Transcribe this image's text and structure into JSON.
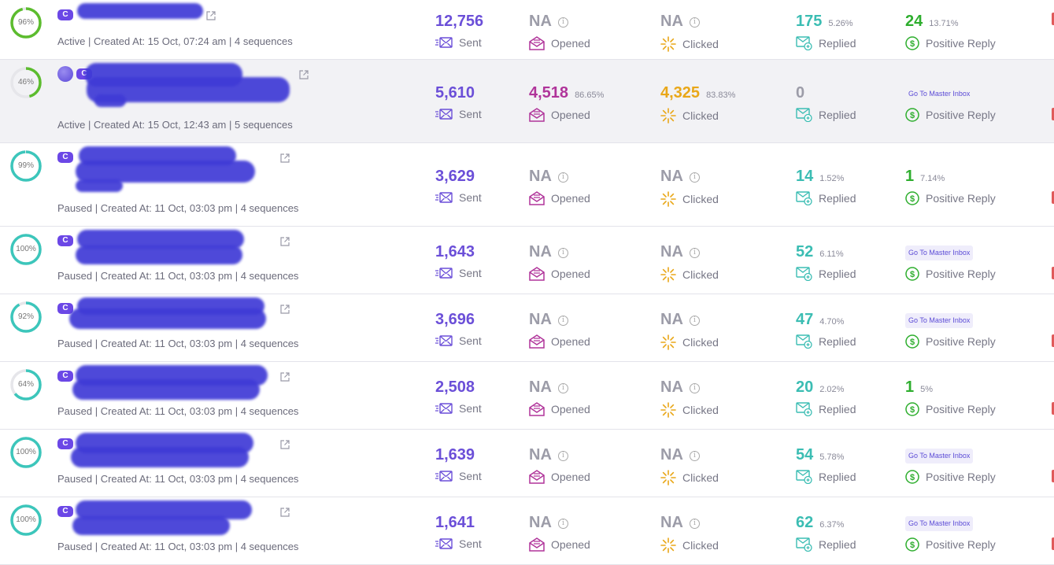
{
  "colors": {
    "sent": "#6b4fd8",
    "opened": "#b0349a",
    "clicked": "#e9a718",
    "replied": "#3bbdb3",
    "positive": "#2eae2e",
    "na": "#9c9ca8",
    "ring_green": "#5cbc2e",
    "ring_teal": "#3cc6bb"
  },
  "labels": {
    "sent": "Sent",
    "opened": "Opened",
    "clicked": "Clicked",
    "replied": "Replied",
    "positive_reply": "Positive Reply",
    "go_to_master_inbox": "Go To Master Inbox",
    "badge": "C"
  },
  "icons": [
    "envelope-send-icon",
    "envelope-open-icon",
    "click-burst-icon",
    "reply-mail-icon",
    "dollar-circle-icon",
    "external-link-icon",
    "info-icon"
  ],
  "campaigns": [
    {
      "progress": "96%",
      "progress_value": 0.96,
      "ring": "green",
      "meta": "Active | Created At: 15 Oct, 07:24 am | 4 sequences",
      "sent": "12,756",
      "opened": "NA",
      "opened_pct": "",
      "clicked": "NA",
      "clicked_pct": "",
      "replied": "175",
      "replied_pct": "5.26%",
      "positive": "24",
      "positive_pct": "13.71%",
      "positive_mode": "value"
    },
    {
      "progress": "46%",
      "progress_value": 0.46,
      "ring": "green",
      "meta": "Active | Created At: 15 Oct, 12:43 am | 5 sequences",
      "sent": "5,610",
      "opened": "4,518",
      "opened_pct": "86.65%",
      "clicked": "4,325",
      "clicked_pct": "83.83%",
      "replied": "0",
      "replied_pct": "",
      "positive": "",
      "positive_pct": "",
      "positive_mode": "inbox"
    },
    {
      "progress": "99%",
      "progress_value": 0.99,
      "ring": "teal",
      "meta": "Paused | Created At: 11 Oct, 03:03 pm | 4 sequences",
      "sent": "3,629",
      "opened": "NA",
      "opened_pct": "",
      "clicked": "NA",
      "clicked_pct": "",
      "replied": "14",
      "replied_pct": "1.52%",
      "positive": "1",
      "positive_pct": "7.14%",
      "positive_mode": "value"
    },
    {
      "progress": "100%",
      "progress_value": 1.0,
      "ring": "teal",
      "meta": "Paused | Created At: 11 Oct, 03:03 pm | 4 sequences",
      "sent": "1,643",
      "opened": "NA",
      "opened_pct": "",
      "clicked": "NA",
      "clicked_pct": "",
      "replied": "52",
      "replied_pct": "6.11%",
      "positive": "",
      "positive_pct": "",
      "positive_mode": "inbox"
    },
    {
      "progress": "92%",
      "progress_value": 0.92,
      "ring": "teal",
      "meta": "Paused | Created At: 11 Oct, 03:03 pm | 4 sequences",
      "sent": "3,696",
      "opened": "NA",
      "opened_pct": "",
      "clicked": "NA",
      "clicked_pct": "",
      "replied": "47",
      "replied_pct": "4.70%",
      "positive": "",
      "positive_pct": "",
      "positive_mode": "inbox"
    },
    {
      "progress": "64%",
      "progress_value": 0.64,
      "ring": "teal",
      "meta": "Paused | Created At: 11 Oct, 03:03 pm | 4 sequences",
      "sent": "2,508",
      "opened": "NA",
      "opened_pct": "",
      "clicked": "NA",
      "clicked_pct": "",
      "replied": "20",
      "replied_pct": "2.02%",
      "positive": "1",
      "positive_pct": "5%",
      "positive_mode": "value"
    },
    {
      "progress": "100%",
      "progress_value": 1.0,
      "ring": "teal",
      "meta": "Paused | Created At: 11 Oct, 03:03 pm | 4 sequences",
      "sent": "1,639",
      "opened": "NA",
      "opened_pct": "",
      "clicked": "NA",
      "clicked_pct": "",
      "replied": "54",
      "replied_pct": "5.78%",
      "positive": "",
      "positive_pct": "",
      "positive_mode": "inbox"
    },
    {
      "progress": "100%",
      "progress_value": 1.0,
      "ring": "teal",
      "meta": "Paused | Created At: 11 Oct, 03:03 pm | 4 sequences",
      "sent": "1,641",
      "opened": "NA",
      "opened_pct": "",
      "clicked": "NA",
      "clicked_pct": "",
      "replied": "62",
      "replied_pct": "6.37%",
      "positive": "",
      "positive_pct": "",
      "positive_mode": "inbox"
    }
  ]
}
